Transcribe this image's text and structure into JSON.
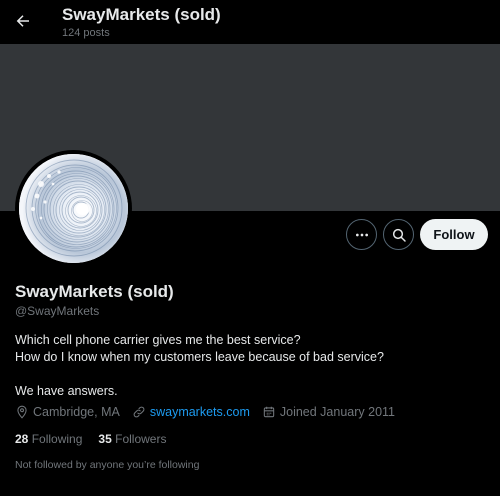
{
  "header": {
    "title": "SwayMarkets (sold)",
    "post_count": "124 posts"
  },
  "profile": {
    "name": "SwayMarkets (sold)",
    "handle": "@SwayMarkets",
    "bio_lines": [
      "Which cell phone carrier gives me the best service?",
      "How do I know when my customers leave because of bad service?",
      "",
      "We have answers."
    ],
    "location": "Cambridge, MA",
    "website": "swaymarkets.com",
    "joined": "Joined January 2011",
    "following_count": "28",
    "following_label": "Following",
    "followers_count": "35",
    "followers_label": "Followers",
    "followed_by": "Not followed by anyone you’re following"
  },
  "actions": {
    "follow_label": "Follow"
  },
  "colors": {
    "background": "#000000",
    "banner": "#333639",
    "link": "#1d9bf0",
    "secondary_text": "#71767b",
    "primary_text": "#e7e9ea"
  }
}
